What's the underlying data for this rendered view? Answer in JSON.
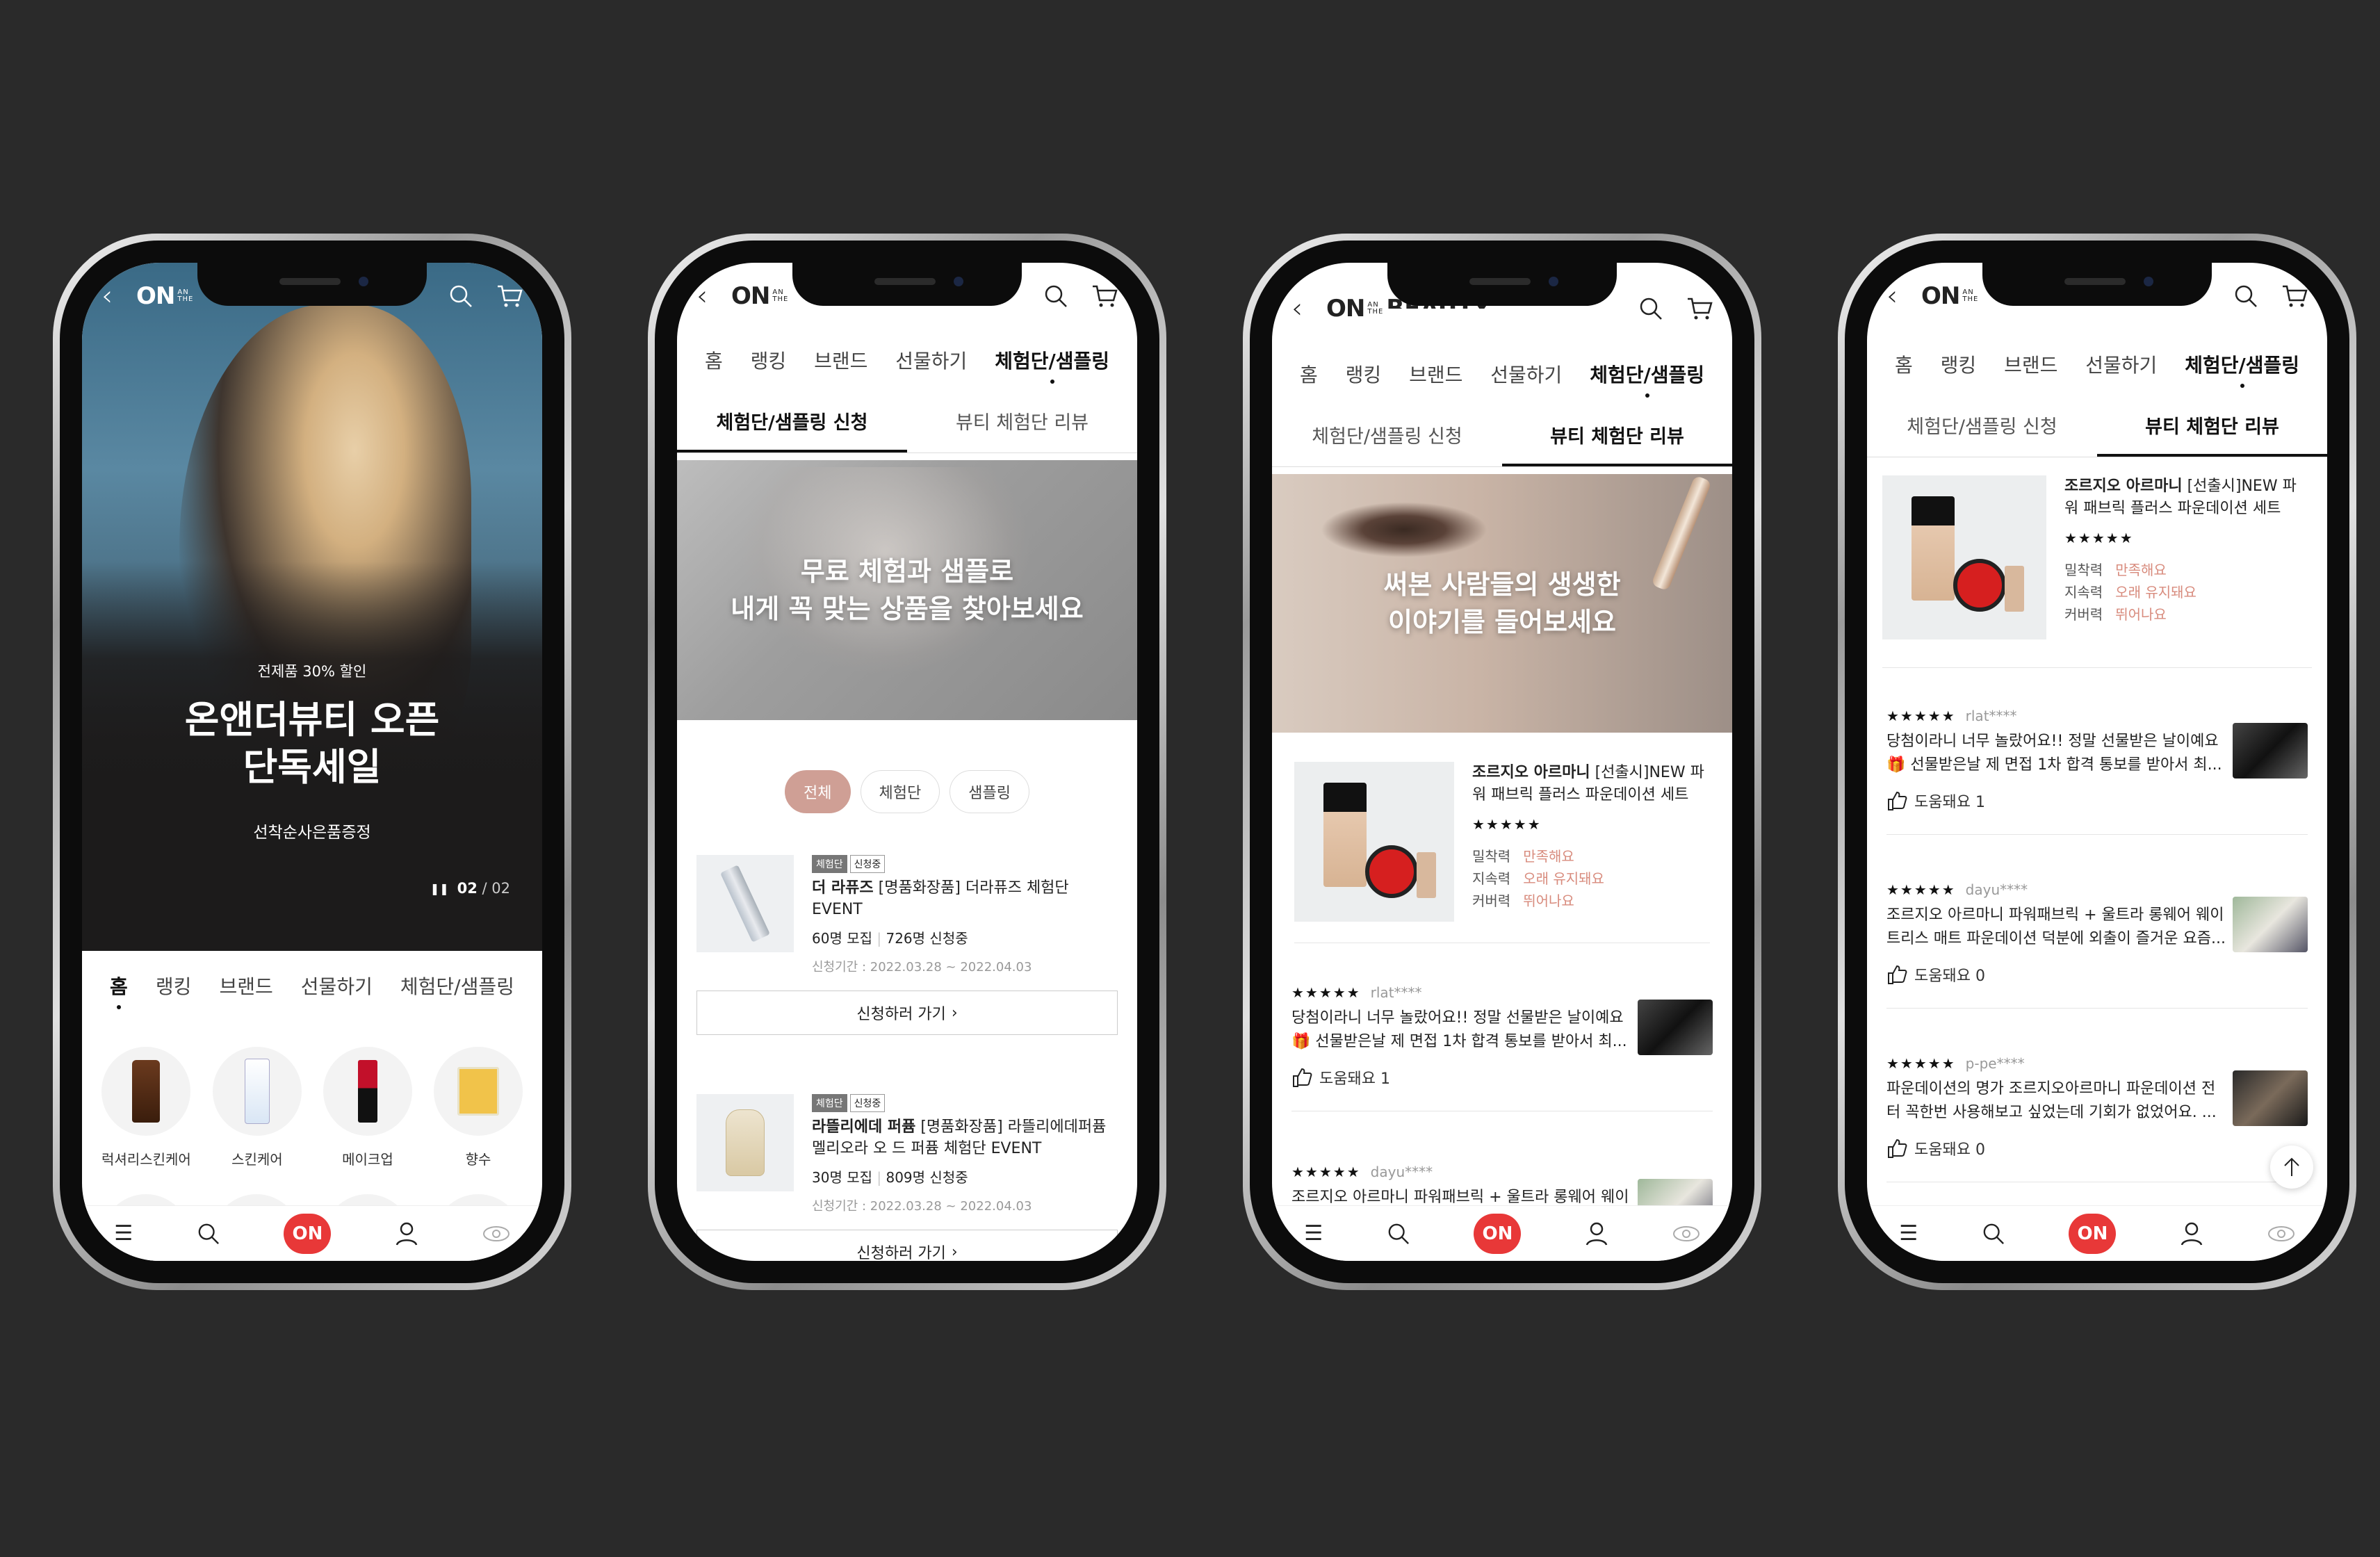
{
  "header": {
    "logo_on": "ON",
    "logo_sub_1": "AN",
    "logo_sub_2": "THE",
    "logo_beauty": "BEAUTY"
  },
  "nav": {
    "home": "홈",
    "ranking": "랭킹",
    "brand": "브랜드",
    "gift": "선물하기",
    "trial": "체험단/샘플링"
  },
  "subtabs": {
    "apply": "체험단/샘플링 신청",
    "review": "뷰티 체험단 리뷰"
  },
  "bottom": {
    "on_label": "ON"
  },
  "phone1": {
    "promo": "전제품 30% 할인",
    "title_1": "온앤더뷰티 오픈",
    "title_2": "단독세일",
    "gift": "선착순사은품증정",
    "pager_current": "02",
    "pager_total": "/ 02",
    "categories": [
      "럭셔리스킨케어",
      "스킨케어",
      "메이크업",
      "향수"
    ]
  },
  "phone2": {
    "banner_1": "무료 체험과 샘플로",
    "banner_2": "내게 꼭 맞는 상품을 찾아보세요",
    "filters": [
      "전체",
      "체험단",
      "샘플링"
    ],
    "items": [
      {
        "tag1": "체험단",
        "tag2": "신청중",
        "brand": "더 라퓨즈",
        "name": "[명품화장품] 더라퓨즈 체험단",
        "name2": "EVENT",
        "recruit": "60명 모집",
        "applied": "726명 신청중",
        "period": "신청기간 : 2022.03.28 ~ 2022.04.03",
        "cta": "신청하러 가기"
      },
      {
        "tag1": "체험단",
        "tag2": "신청중",
        "brand": "라뜰리에데 퍼퓸",
        "name": "[명품화장품] 라뜰리에데퍼퓸",
        "name2": "멜리오라 오 드 퍼퓸 체험단 EVENT",
        "recruit": "30명 모집",
        "applied": "809명 신청중",
        "period": "신청기간 : 2022.03.28 ~ 2022.04.03",
        "cta": "신청하러 가기"
      }
    ]
  },
  "phone3": {
    "banner_1": "써본 사람들의 생생한",
    "banner_2": "이야기를 들어보세요"
  },
  "product": {
    "brand": "조르지오 아르마니",
    "name_1": "[선출시]NEW 파",
    "name_2": "워 패브릭 플러스 파운데이션 세트",
    "stars": "★★★★★",
    "ratings": [
      {
        "label": "밀착력",
        "value": "만족해요"
      },
      {
        "label": "지속력",
        "value": "오래 유지돼요"
      },
      {
        "label": "커버력",
        "value": "뛰어나요"
      }
    ]
  },
  "reviews": [
    {
      "stars": "★★★★★",
      "user": "rlat****",
      "line1": "당첨이라니 너무 놀랐어요!! 정말 선물받은 날이예요",
      "line2": "🎁 선물받은날 제 면접 1차 합격 통보를 받아서 최...",
      "helpful": "도움돼요 1"
    },
    {
      "stars": "★★★★★",
      "user": "dayu****",
      "line1": "조르지오 아르마니 파워패브릭 + 울트라 롱웨어 웨이",
      "line2": "트리스 매트 파운데이션 덕분에 외출이 즐거운 요즘...",
      "helpful": "도움돼요 0"
    },
    {
      "stars": "★★★★★",
      "user": "p-pe****",
      "line1": "파운데이션의 명가 조르지오아르마니 파운데이션 전",
      "line2": "터 꼭한번 사용해보고 싶었는데 기회가 없었어요. ...",
      "helpful": "도움돼요 0"
    }
  ],
  "colors": {
    "accent": "#e83838",
    "chip": "#cf9f95",
    "rating_value": "#d88b7d",
    "background": "#2a2a2a"
  }
}
